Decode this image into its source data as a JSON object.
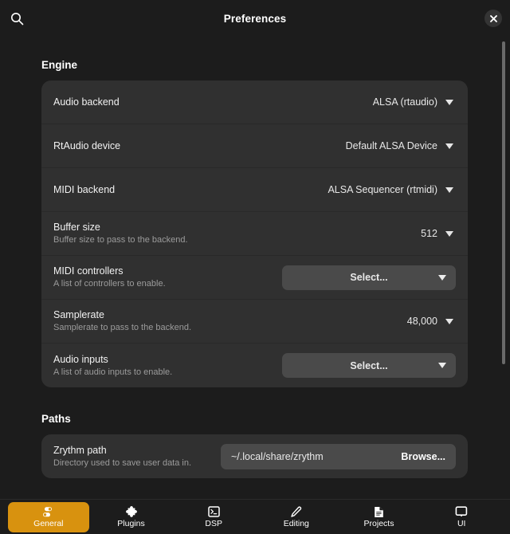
{
  "header": {
    "title": "Preferences",
    "search_icon": "search-icon",
    "close_icon": "close-icon"
  },
  "sections": [
    {
      "title": "Engine",
      "rows": [
        {
          "title": "Audio backend",
          "subtitle": "",
          "control": "dropdown",
          "value": "ALSA (rtaudio)"
        },
        {
          "title": "RtAudio device",
          "subtitle": "",
          "control": "dropdown",
          "value": "Default ALSA Device"
        },
        {
          "title": "MIDI backend",
          "subtitle": "",
          "control": "dropdown",
          "value": "ALSA Sequencer (rtmidi)"
        },
        {
          "title": "Buffer size",
          "subtitle": "Buffer size to pass to the backend.",
          "control": "dropdown",
          "value": "512"
        },
        {
          "title": "MIDI controllers",
          "subtitle": "A list of controllers to enable.",
          "control": "button",
          "value": "Select..."
        },
        {
          "title": "Samplerate",
          "subtitle": "Samplerate to pass to the backend.",
          "control": "dropdown",
          "value": "48,000"
        },
        {
          "title": "Audio inputs",
          "subtitle": "A list of audio inputs to enable.",
          "control": "button",
          "value": "Select..."
        }
      ]
    },
    {
      "title": "Paths",
      "rows": [
        {
          "title": "Zrythm path",
          "subtitle": "Directory used to save user data in.",
          "control": "path",
          "value": "~/.local/share/zrythm",
          "browse_label": "Browse..."
        }
      ]
    }
  ],
  "bottom_nav": {
    "items": [
      {
        "label": "General",
        "icon": "toggles-icon",
        "active": true
      },
      {
        "label": "Plugins",
        "icon": "puzzle-piece-icon",
        "active": false
      },
      {
        "label": "DSP",
        "icon": "terminal-icon",
        "active": false
      },
      {
        "label": "Editing",
        "icon": "pencil-icon",
        "active": false
      },
      {
        "label": "Projects",
        "icon": "document-icon",
        "active": false
      },
      {
        "label": "UI",
        "icon": "monitor-icon",
        "active": false
      }
    ]
  },
  "colors": {
    "accent": "#d8920f",
    "page_background": "#1c1c1c",
    "card_background": "#303030",
    "control_background": "#4a4a4a"
  }
}
